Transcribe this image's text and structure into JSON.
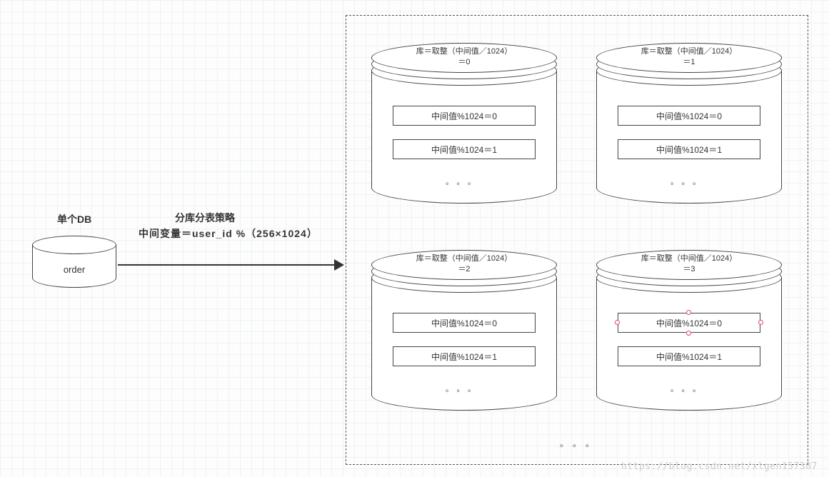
{
  "single_db": {
    "title": "单个DB",
    "name": "order"
  },
  "strategy": {
    "line1": "分库分表策略",
    "line2": "中间变量＝user_id %（256×1024）"
  },
  "databases": [
    {
      "title_l1": "库＝取整（中间值／1024）",
      "title_l2": "＝0",
      "table0": "中间值%1024＝0",
      "table1": "中间值%1024＝1",
      "dots": "。。。"
    },
    {
      "title_l1": "库＝取整（中间值／1024）",
      "title_l2": "＝1",
      "table0": "中间值%1024＝0",
      "table1": "中间值%1024＝1",
      "dots": "。。。"
    },
    {
      "title_l1": "库＝取整（中间值／1024）",
      "title_l2": "＝2",
      "table0": "中间值%1024＝0",
      "table1": "中间值%1024＝1",
      "dots": "。。。"
    },
    {
      "title_l1": "库＝取整（中间值／1024）",
      "title_l2": "＝3",
      "table0": "中间值%1024＝0",
      "table1": "中间值%1024＝1",
      "dots": "。。。"
    }
  ],
  "group_dots": "。。。",
  "watermark": "https://blog.csdn.net/xlgen157387"
}
